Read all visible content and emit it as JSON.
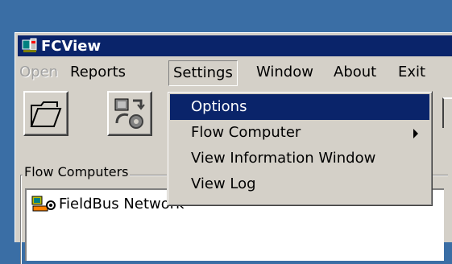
{
  "window": {
    "title": "FCView",
    "app_icon": "fcview-app-icon"
  },
  "menubar": {
    "items": [
      {
        "label": "Open",
        "state": "disabled"
      },
      {
        "label": "Reports",
        "state": "normal"
      },
      {
        "label": "Settings",
        "state": "open"
      },
      {
        "label": "Window",
        "state": "normal"
      },
      {
        "label": "About",
        "state": "normal"
      },
      {
        "label": "Exit",
        "state": "normal"
      }
    ]
  },
  "toolbar": {
    "buttons": [
      {
        "icon": "open-folder-icon"
      },
      {
        "icon": "flow-computer-tool-icon"
      }
    ]
  },
  "settings_menu": {
    "items": [
      {
        "label": "Options",
        "highlighted": true
      },
      {
        "label": "Flow Computer",
        "has_submenu": true
      },
      {
        "label": "View Information Window"
      },
      {
        "label": "View Log"
      }
    ]
  },
  "flow_computers": {
    "group_label": "Flow Computers",
    "tree": [
      {
        "label": "FieldBus Network",
        "icon": "fieldbus-network-icon"
      }
    ]
  },
  "colors": {
    "desktop": "#3a6ea5",
    "face": "#d4d0c8",
    "highlight": "#0a246a",
    "title_bar": "#0a246a",
    "disabled_text": "#a0a0a0"
  }
}
